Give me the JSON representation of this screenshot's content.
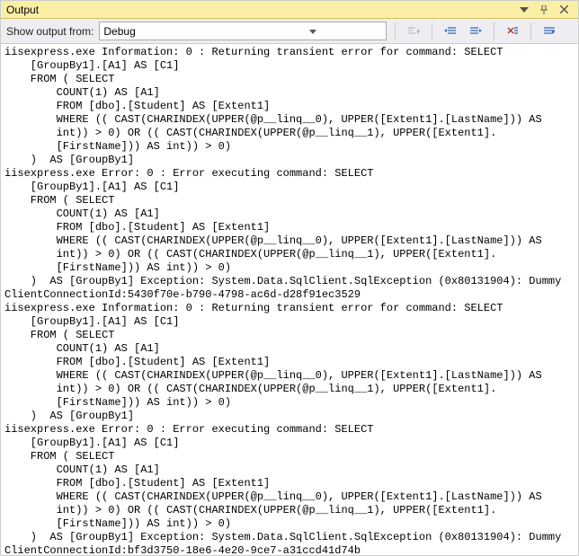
{
  "title": "Output",
  "toolbar": {
    "label": "Show output from:",
    "source_selected": "Debug"
  },
  "buttons": {
    "clear_all": "Clear All",
    "toggle_wrap": "Toggle Word Wrap",
    "find_prev": "Find Previous",
    "find_next": "Find Next",
    "options": "Options"
  },
  "log_lines": [
    "iisexpress.exe Information: 0 : Returning transient error for command: SELECT ",
    "    [GroupBy1].[A1] AS [C1]",
    "    FROM ( SELECT ",
    "        COUNT(1) AS [A1]",
    "        FROM [dbo].[Student] AS [Extent1]",
    "        WHERE (( CAST(CHARINDEX(UPPER(@p__linq__0), UPPER([Extent1].[LastName])) AS ",
    "        int)) > 0) OR (( CAST(CHARINDEX(UPPER(@p__linq__1), UPPER([Extent1].",
    "        [FirstName])) AS int)) > 0)",
    "    )  AS [GroupBy1]",
    "iisexpress.exe Error: 0 : Error executing command: SELECT ",
    "    [GroupBy1].[A1] AS [C1]",
    "    FROM ( SELECT ",
    "        COUNT(1) AS [A1]",
    "        FROM [dbo].[Student] AS [Extent1]",
    "        WHERE (( CAST(CHARINDEX(UPPER(@p__linq__0), UPPER([Extent1].[LastName])) AS ",
    "        int)) > 0) OR (( CAST(CHARINDEX(UPPER(@p__linq__1), UPPER([Extent1].",
    "        [FirstName])) AS int)) > 0)",
    "    )  AS [GroupBy1] Exception: System.Data.SqlClient.SqlException (0x80131904): Dummy",
    "ClientConnectionId:5430f70e-b790-4798-ac6d-d28f91ec3529",
    "iisexpress.exe Information: 0 : Returning transient error for command: SELECT ",
    "    [GroupBy1].[A1] AS [C1]",
    "    FROM ( SELECT ",
    "        COUNT(1) AS [A1]",
    "        FROM [dbo].[Student] AS [Extent1]",
    "        WHERE (( CAST(CHARINDEX(UPPER(@p__linq__0), UPPER([Extent1].[LastName])) AS ",
    "        int)) > 0) OR (( CAST(CHARINDEX(UPPER(@p__linq__1), UPPER([Extent1].",
    "        [FirstName])) AS int)) > 0)",
    "    )  AS [GroupBy1]",
    "iisexpress.exe Error: 0 : Error executing command: SELECT ",
    "    [GroupBy1].[A1] AS [C1]",
    "    FROM ( SELECT ",
    "        COUNT(1) AS [A1]",
    "        FROM [dbo].[Student] AS [Extent1]",
    "        WHERE (( CAST(CHARINDEX(UPPER(@p__linq__0), UPPER([Extent1].[LastName])) AS ",
    "        int)) > 0) OR (( CAST(CHARINDEX(UPPER(@p__linq__1), UPPER([Extent1].",
    "        [FirstName])) AS int)) > 0)",
    "    )  AS [GroupBy1] Exception: System.Data.SqlClient.SqlException (0x80131904): Dummy",
    "ClientConnectionId:bf3d3750-18e6-4e20-9ce7-a31ccd41d74b"
  ]
}
